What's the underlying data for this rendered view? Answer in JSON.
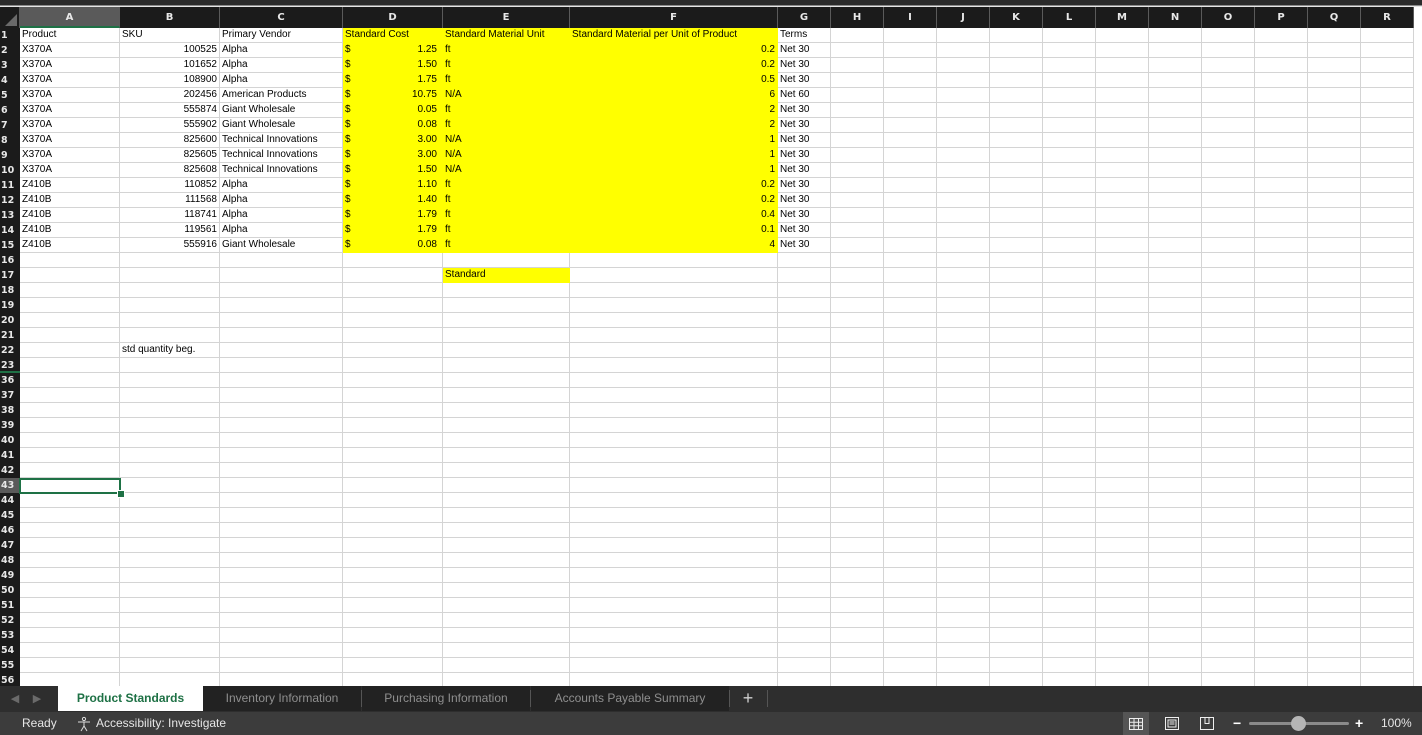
{
  "columns": [
    "A",
    "B",
    "C",
    "D",
    "E",
    "F",
    "G",
    "H",
    "I",
    "J",
    "K",
    "L",
    "M",
    "N",
    "O",
    "P",
    "Q",
    "R"
  ],
  "selected_column": "A",
  "selected_row": "43",
  "headers": {
    "product": "Product",
    "sku": "SKU",
    "vendor": "Primary Vendor",
    "cost": "Standard Cost",
    "unit": "Standard Material Unit",
    "per_unit": "Standard Material per Unit of Product",
    "terms": "Terms"
  },
  "currency_symbol": "$",
  "rows": [
    {
      "product": "X370A",
      "sku": "100525",
      "vendor": "Alpha",
      "cost": "1.25",
      "unit": "ft",
      "per_unit": "0.2",
      "terms": "Net 30"
    },
    {
      "product": "X370A",
      "sku": "101652",
      "vendor": "Alpha",
      "cost": "1.50",
      "unit": "ft",
      "per_unit": "0.2",
      "terms": "Net 30"
    },
    {
      "product": "X370A",
      "sku": "108900",
      "vendor": "Alpha",
      "cost": "1.75",
      "unit": "ft",
      "per_unit": "0.5",
      "terms": "Net 30"
    },
    {
      "product": "X370A",
      "sku": "202456",
      "vendor": "American Products",
      "cost": "10.75",
      "unit": "N/A",
      "per_unit": "6",
      "terms": "Net 60"
    },
    {
      "product": "X370A",
      "sku": "555874",
      "vendor": "Giant Wholesale",
      "cost": "0.05",
      "unit": "ft",
      "per_unit": "2",
      "terms": "Net 30"
    },
    {
      "product": "X370A",
      "sku": "555902",
      "vendor": "Giant Wholesale",
      "cost": "0.08",
      "unit": "ft",
      "per_unit": "2",
      "terms": "Net 30"
    },
    {
      "product": "X370A",
      "sku": "825600",
      "vendor": "Technical Innovations",
      "cost": "3.00",
      "unit": "N/A",
      "per_unit": "1",
      "terms": "Net 30"
    },
    {
      "product": "X370A",
      "sku": "825605",
      "vendor": "Technical Innovations",
      "cost": "3.00",
      "unit": "N/A",
      "per_unit": "1",
      "terms": "Net 30"
    },
    {
      "product": "X370A",
      "sku": "825608",
      "vendor": "Technical Innovations",
      "cost": "1.50",
      "unit": "N/A",
      "per_unit": "1",
      "terms": "Net 30"
    },
    {
      "product": "Z410B",
      "sku": "110852",
      "vendor": "Alpha",
      "cost": "1.10",
      "unit": "ft",
      "per_unit": "0.2",
      "terms": "Net 30"
    },
    {
      "product": "Z410B",
      "sku": "111568",
      "vendor": "Alpha",
      "cost": "1.40",
      "unit": "ft",
      "per_unit": "0.2",
      "terms": "Net 30"
    },
    {
      "product": "Z410B",
      "sku": "118741",
      "vendor": "Alpha",
      "cost": "1.79",
      "unit": "ft",
      "per_unit": "0.4",
      "terms": "Net 30"
    },
    {
      "product": "Z410B",
      "sku": "119561",
      "vendor": "Alpha",
      "cost": "1.79",
      "unit": "ft",
      "per_unit": "0.1",
      "terms": "Net 30"
    },
    {
      "product": "Z410B",
      "sku": "555916",
      "vendor": "Giant Wholesale",
      "cost": "0.08",
      "unit": "ft",
      "per_unit": "4",
      "terms": "Net 30"
    }
  ],
  "extra_cells": {
    "e17": "Standard",
    "b22": "std quantity beg."
  },
  "row_numbers": [
    "1",
    "2",
    "3",
    "4",
    "5",
    "6",
    "7",
    "8",
    "9",
    "10",
    "11",
    "12",
    "13",
    "14",
    "15",
    "16",
    "17",
    "18",
    "19",
    "20",
    "21",
    "22",
    "23",
    "36",
    "37",
    "38",
    "39",
    "40",
    "41",
    "42",
    "43",
    "44",
    "45",
    "46",
    "47",
    "48",
    "49",
    "50",
    "51",
    "52",
    "53",
    "54",
    "55",
    "56"
  ],
  "sheet_tabs": [
    {
      "label": "Product Standards",
      "active": true
    },
    {
      "label": "Inventory Information",
      "active": false
    },
    {
      "label": "Purchasing Information",
      "active": false
    },
    {
      "label": "Accounts Payable Summary",
      "active": false
    }
  ],
  "add_sheet_label": "+",
  "status": {
    "ready": "Ready",
    "accessibility": "Accessibility: Investigate",
    "zoom_percent": "100%",
    "zoom_level": 100
  },
  "colors": {
    "highlight": "#ffff00",
    "accent": "#1e7145"
  }
}
